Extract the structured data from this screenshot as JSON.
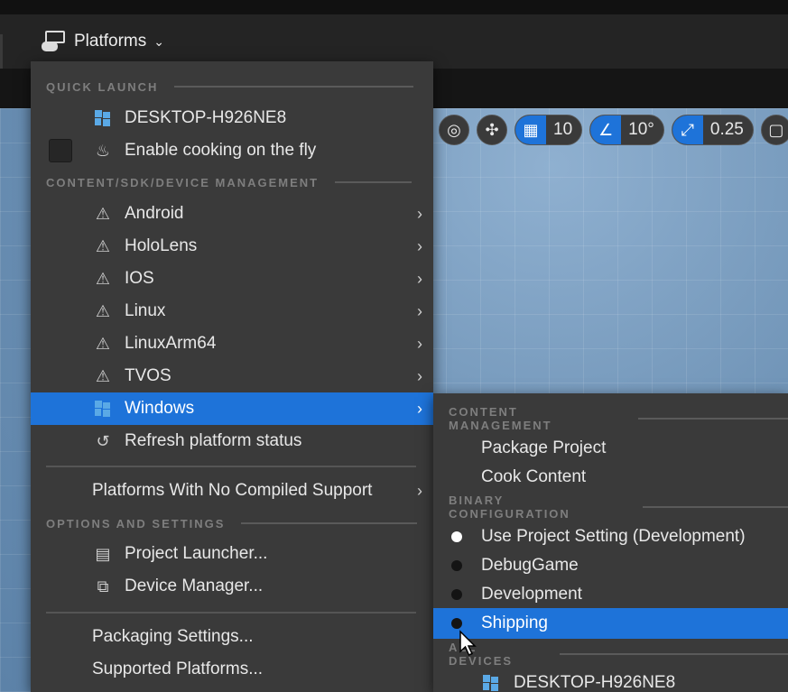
{
  "toolbar": {
    "platforms_label": "Platforms",
    "platforms_icon": "platforms-icon",
    "chevron_icon": "chevron-down-icon"
  },
  "viewport_toolbar": {
    "grid_snap_value": "10",
    "rotation_snap_value": "10°",
    "scale_snap_value": "0.25"
  },
  "menu": {
    "sections": {
      "quick_launch": "QUICK LAUNCH",
      "content_sdk": "CONTENT/SDK/DEVICE MANAGEMENT",
      "options": "OPTIONS AND SETTINGS"
    },
    "quick_launch_device": "DESKTOP-H926NE8",
    "enable_cooking": "Enable cooking on the fly",
    "platforms": [
      "Android",
      "HoloLens",
      "IOS",
      "Linux",
      "LinuxArm64",
      "TVOS"
    ],
    "windows": "Windows",
    "refresh": "Refresh platform status",
    "no_compiled": "Platforms With No Compiled Support",
    "project_launcher": "Project Launcher...",
    "device_manager": "Device Manager...",
    "packaging_settings": "Packaging Settings...",
    "supported_platforms": "Supported Platforms..."
  },
  "submenu": {
    "sections": {
      "content_management": "CONTENT MANAGEMENT",
      "binary_configuration": "BINARY CONFIGURATION",
      "all_devices": "ALL DEVICES"
    },
    "package_project": "Package Project",
    "cook_content": "Cook Content",
    "configs": [
      "Use Project Setting (Development)",
      "DebugGame",
      "Development",
      "Shipping"
    ],
    "selected_config_index": 0,
    "hovered_config": "Shipping",
    "device": "DESKTOP-H926NE8"
  },
  "colors": {
    "menu_bg": "#3a3a3a",
    "highlight": "#1e73d9",
    "header_text": "#7e7e7e",
    "viewport": "#6b90b4"
  }
}
